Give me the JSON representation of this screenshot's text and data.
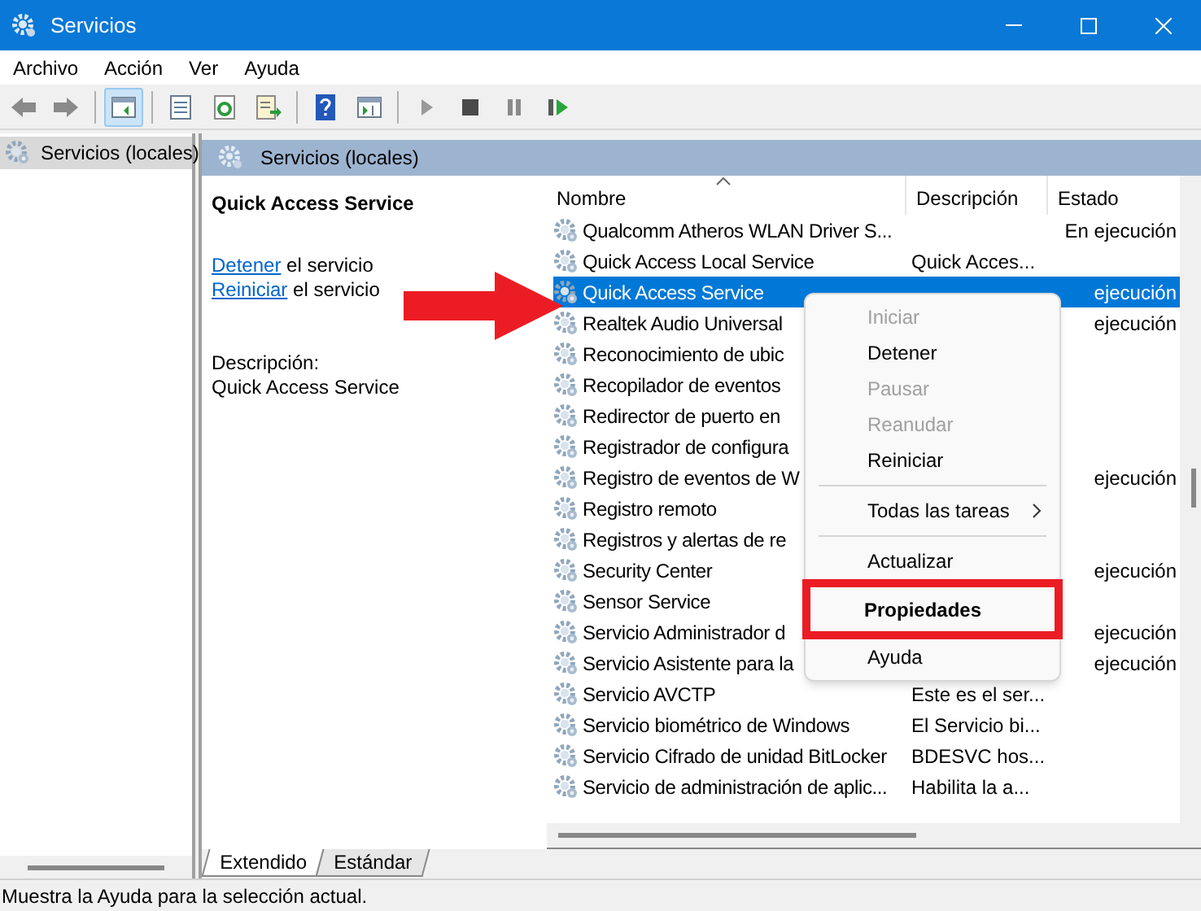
{
  "window": {
    "title": "Servicios"
  },
  "menu_bar": [
    "Archivo",
    "Acción",
    "Ver",
    "Ayuda"
  ],
  "toolbar": [
    {
      "kind": "back",
      "selected": false
    },
    {
      "kind": "forward",
      "selected": false
    },
    {
      "kind": "sep"
    },
    {
      "kind": "pane",
      "selected": true
    },
    {
      "kind": "sep"
    },
    {
      "kind": "list",
      "selected": false
    },
    {
      "kind": "refresh",
      "selected": false
    },
    {
      "kind": "export",
      "selected": false
    },
    {
      "kind": "sep"
    },
    {
      "kind": "help",
      "selected": false
    },
    {
      "kind": "pane2",
      "selected": false
    },
    {
      "kind": "sep"
    },
    {
      "kind": "play",
      "selected": false
    },
    {
      "kind": "stop",
      "selected": false
    },
    {
      "kind": "pause",
      "selected": false
    },
    {
      "kind": "resume",
      "selected": false
    }
  ],
  "tree": [
    {
      "label": "Servicios (locales)",
      "selected": true
    }
  ],
  "pane_header": "Servicios (locales)",
  "detail": {
    "title": "Quick Access Service",
    "actions": [
      {
        "link": "Detener",
        "text": " el servicio"
      },
      {
        "link": "Reiniciar",
        "text": " el servicio"
      }
    ],
    "description_label": "Descripción:",
    "description": "Quick Access Service"
  },
  "table": {
    "columns": [
      "Nombre",
      "Descripción",
      "Estado"
    ],
    "rows": [
      {
        "name": "Qualcomm Atheros WLAN Driver S...",
        "description": "",
        "state": "En ejecución",
        "selected": false,
        "marked": false
      },
      {
        "name": "Quick Access Local Service",
        "description": "Quick Acces...",
        "state": "",
        "selected": false,
        "marked": false
      },
      {
        "name": "Quick Access Service",
        "description": "",
        "state": "ejecución",
        "selected": true,
        "marked": true
      },
      {
        "name": "Realtek Audio Universal",
        "description": "",
        "state": "ejecución",
        "selected": false,
        "marked": false
      },
      {
        "name": "Reconocimiento de ubic",
        "description": "",
        "state": "",
        "selected": false,
        "marked": false
      },
      {
        "name": "Recopilador de eventos",
        "description": "",
        "state": "",
        "selected": false,
        "marked": false
      },
      {
        "name": "Redirector de puerto en",
        "description": "",
        "state": "",
        "selected": false,
        "marked": false
      },
      {
        "name": "Registrador de configura",
        "description": "",
        "state": "",
        "selected": false,
        "marked": false
      },
      {
        "name": "Registro de eventos de W",
        "description": "",
        "state": "ejecución",
        "selected": false,
        "marked": false
      },
      {
        "name": "Registro remoto",
        "description": "",
        "state": "",
        "selected": false,
        "marked": false
      },
      {
        "name": "Registros y alertas de re",
        "description": "",
        "state": "",
        "selected": false,
        "marked": false
      },
      {
        "name": "Security Center",
        "description": "",
        "state": "ejecución",
        "selected": false,
        "marked": false
      },
      {
        "name": "Sensor Service",
        "description": "",
        "state": "",
        "selected": false,
        "marked": false
      },
      {
        "name": "Servicio Administrador d",
        "description": "",
        "state": "ejecución",
        "selected": false,
        "marked": false
      },
      {
        "name": "Servicio Asistente para la",
        "description": "",
        "state": "ejecución",
        "selected": false,
        "marked": false
      },
      {
        "name": "Servicio AVCTP",
        "description": "Este es el ser...",
        "state": "",
        "selected": false,
        "marked": false
      },
      {
        "name": "Servicio biométrico de Windows",
        "description": "El Servicio bi...",
        "state": "",
        "selected": false,
        "marked": false
      },
      {
        "name": "Servicio Cifrado de unidad BitLocker",
        "description": "BDESVC hos...",
        "state": "",
        "selected": false,
        "marked": false
      },
      {
        "name": "Servicio de administración de aplic...",
        "description": "Habilita la a...",
        "state": "",
        "selected": false,
        "marked": false
      }
    ]
  },
  "context_menu": [
    {
      "kind": "item",
      "label": "Iniciar",
      "disabled": true,
      "highlighted": false
    },
    {
      "kind": "item",
      "label": "Detener",
      "disabled": false,
      "highlighted": false
    },
    {
      "kind": "item",
      "label": "Pausar",
      "disabled": true,
      "highlighted": false
    },
    {
      "kind": "item",
      "label": "Reanudar",
      "disabled": true,
      "highlighted": false
    },
    {
      "kind": "item",
      "label": "Reiniciar",
      "disabled": false,
      "highlighted": false
    },
    {
      "kind": "separator"
    },
    {
      "kind": "submenu",
      "label": "Todas las tareas",
      "disabled": false,
      "highlighted": false
    },
    {
      "kind": "separator"
    },
    {
      "kind": "item",
      "label": "Actualizar",
      "disabled": false,
      "highlighted": false
    },
    {
      "kind": "item",
      "label": "Propiedades",
      "disabled": false,
      "highlighted": true,
      "bold": true
    },
    {
      "kind": "item",
      "label": "Ayuda",
      "disabled": false,
      "highlighted": false
    }
  ],
  "tabs": [
    {
      "label": "Extendido",
      "selected": true
    },
    {
      "label": "Estándar",
      "selected": false
    }
  ],
  "status_bar": "Muestra la Ayuda para la selección actual."
}
